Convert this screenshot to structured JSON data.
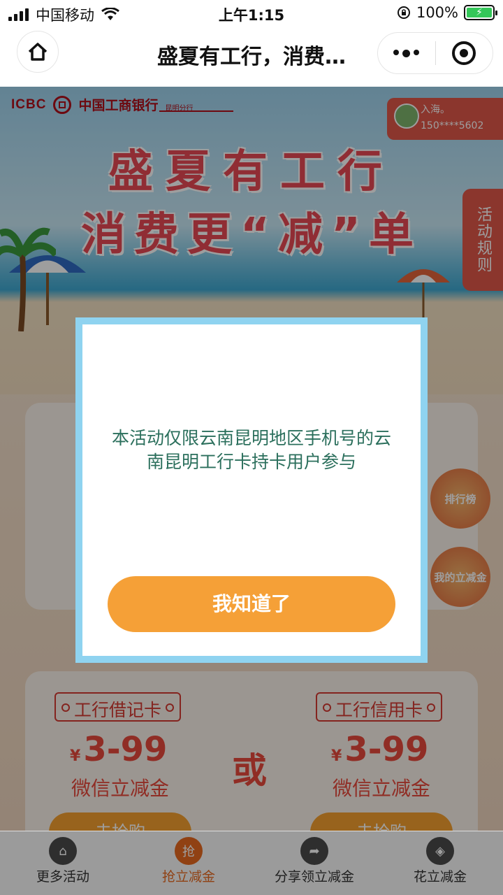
{
  "status_bar": {
    "carrier": "中国移动",
    "time": "上午1:15",
    "battery_percent": "100%"
  },
  "nav": {
    "title": "盛夏有工行，消费…"
  },
  "page": {
    "logo_text": "ICBC",
    "bank_name": "中国工商银行",
    "branch": "昆明分行",
    "user_name": "入海。",
    "user_phone": "150****5602",
    "headline_1": "盛夏有工行",
    "headline_2": "消费更“减”单",
    "rules_tab": "活动规则",
    "badge_rank": "排行榜",
    "badge_mine": "我的立减金",
    "card2": {
      "debit_tag": "工行借记卡",
      "credit_tag": "工行信用卡",
      "currency": "¥",
      "debit_amount": "3-99",
      "credit_amount": "3-99",
      "debit_label": "微信立减金",
      "credit_label": "微信立减金",
      "or": "或",
      "buy_label": "去抢购"
    }
  },
  "modal": {
    "message": "本活动仅限云南昆明地区手机号的云南昆明工行卡持卡用户参与",
    "button": "我知道了"
  },
  "tabs": [
    {
      "label": "更多活动",
      "icon": "home-icon",
      "glyph": "⌂"
    },
    {
      "label": "抢立减金",
      "icon": "grab-icon",
      "glyph": "抢",
      "active": true
    },
    {
      "label": "分享领立减金",
      "icon": "share-icon",
      "glyph": "➦"
    },
    {
      "label": "花立减金",
      "icon": "tag-icon",
      "glyph": "◈"
    }
  ],
  "colors": {
    "brand_red": "#d53a33",
    "accent_orange": "#f5a037",
    "modal_border": "#8fd3f0",
    "modal_text": "#2b6f5c"
  }
}
